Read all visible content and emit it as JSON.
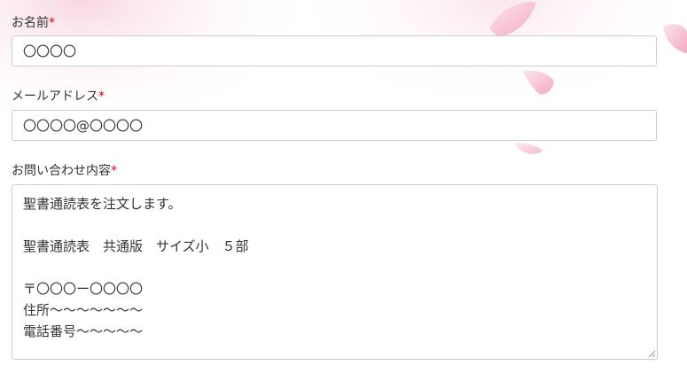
{
  "form": {
    "name": {
      "label": "お名前",
      "required_mark": "*",
      "value": "〇〇〇〇"
    },
    "email": {
      "label": "メールアドレス",
      "required_mark": "*",
      "value": "〇〇〇〇@〇〇〇〇"
    },
    "inquiry": {
      "label": "お問い合わせ内容",
      "required_mark": "*",
      "lines": [
        "聖書通読表を注文します。",
        "",
        "聖書通読表　共通版　サイズ小　５部",
        "",
        "〒〇〇〇ー〇〇〇〇",
        "住所〜〜〜〜〜〜〜",
        "電話番号〜〜〜〜〜"
      ]
    }
  },
  "colors": {
    "required": "#e60012",
    "petal": "#f5b9c9",
    "border": "#cccccc"
  }
}
